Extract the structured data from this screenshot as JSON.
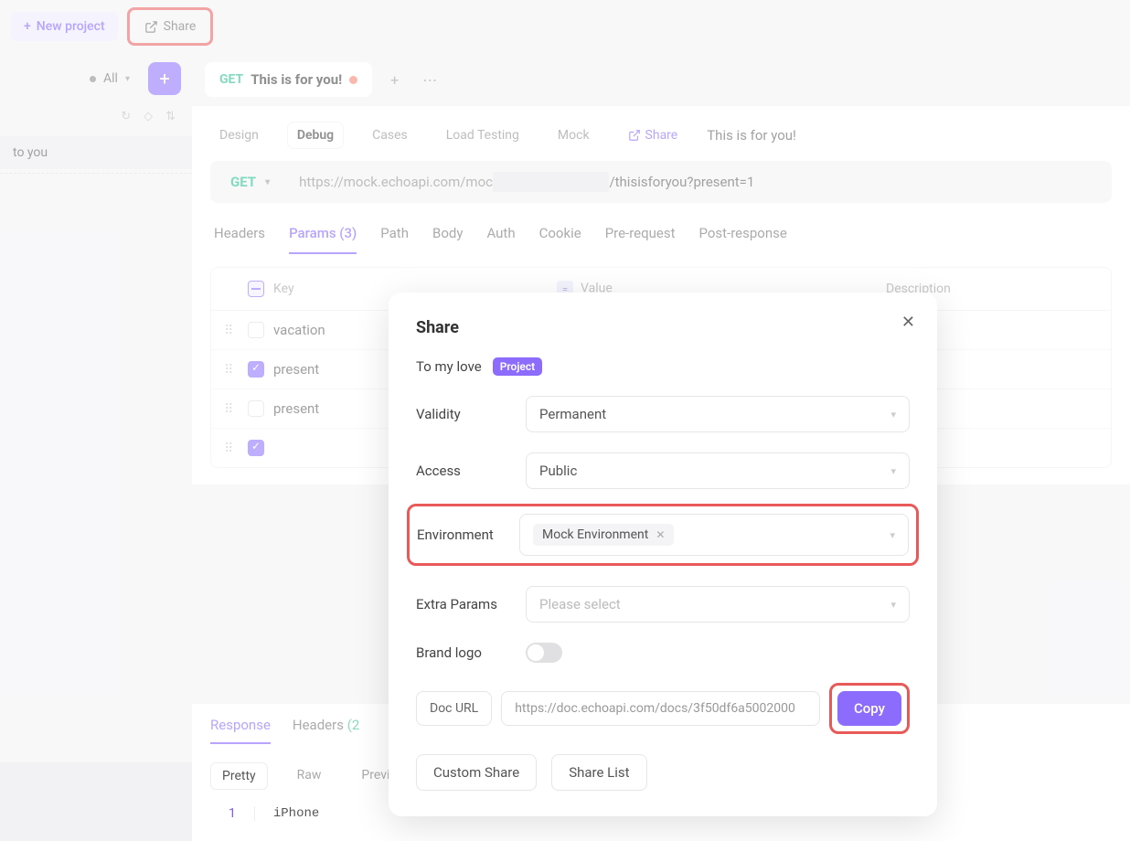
{
  "topbar": {
    "new_project": "New project",
    "share": "Share"
  },
  "sidebar": {
    "all": "All",
    "items": [
      "to you",
      ""
    ]
  },
  "tab": {
    "method": "GET",
    "title": "This is for you!"
  },
  "modes": {
    "design": "Design",
    "debug": "Debug",
    "cases": "Cases",
    "load": "Load Testing",
    "mock": "Mock",
    "share": "Share",
    "breadcrumb": "This is for you!"
  },
  "url": {
    "method": "GET",
    "prefix": "https://mock.echoapi.com/moc",
    "suffix": "/thisisforyou?present=1"
  },
  "reqtabs": {
    "headers": "Headers",
    "params": "Params",
    "params_count": "(3)",
    "path": "Path",
    "body": "Body",
    "auth": "Auth",
    "cookie": "Cookie",
    "prereq": "Pre-request",
    "postresp": "Post-response"
  },
  "params_header": {
    "key": "Key",
    "value": "Value",
    "desc": "Description"
  },
  "params": [
    {
      "key": "vacation",
      "checked": false
    },
    {
      "key": "present",
      "checked": true
    },
    {
      "key": "present",
      "checked": false
    },
    {
      "key": "",
      "checked": true
    }
  ],
  "response": {
    "response_tab": "Response",
    "headers_tab": "Headers",
    "headers_count": "(2",
    "pretty": "Pretty",
    "raw": "Raw",
    "preview": "Preview",
    "line_no": "1",
    "line_text": "iPhone"
  },
  "modal": {
    "title": "Share",
    "to": "To my love",
    "badge": "Project",
    "validity_label": "Validity",
    "validity_value": "Permanent",
    "access_label": "Access",
    "access_value": "Public",
    "env_label": "Environment",
    "env_value": "Mock Environment",
    "extra_label": "Extra Params",
    "extra_placeholder": "Please select",
    "brand_label": "Brand logo",
    "docurl_label": "Doc URL",
    "docurl_value": "https://doc.echoapi.com/docs/3f50df6a5002000",
    "copy": "Copy",
    "custom_share": "Custom Share",
    "share_list": "Share List"
  }
}
